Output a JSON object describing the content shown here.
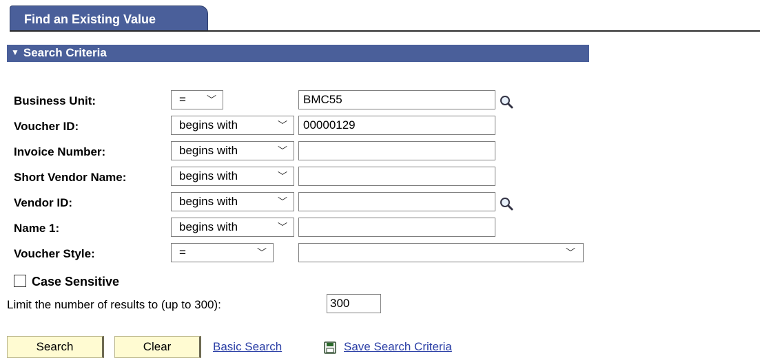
{
  "tab": {
    "label": "Find an Existing Value"
  },
  "section": {
    "title": "Search Criteria"
  },
  "fields": [
    {
      "label": "Business Unit:",
      "operator": "=",
      "value": "BMC55",
      "lookup": true
    },
    {
      "label": "Voucher ID:",
      "operator": "begins with",
      "value": "00000129",
      "lookup": false
    },
    {
      "label": "Invoice Number:",
      "operator": "begins with",
      "value": "",
      "lookup": false
    },
    {
      "label": "Short Vendor Name:",
      "operator": "begins with",
      "value": "",
      "lookup": false
    },
    {
      "label": "Vendor ID:",
      "operator": "begins with",
      "value": "",
      "lookup": true
    },
    {
      "label": "Name 1:",
      "operator": "begins with",
      "value": "",
      "lookup": false
    },
    {
      "label": "Voucher Style:",
      "operator": "=",
      "value": "",
      "lookup": false
    }
  ],
  "case_sensitive": {
    "label": "Case Sensitive",
    "checked": false
  },
  "limit": {
    "label": "Limit the number of results to (up to 300):",
    "value": "300"
  },
  "buttons": {
    "search": "Search",
    "clear": "Clear"
  },
  "links": {
    "basic_search": "Basic Search",
    "save_search_criteria": "Save Search Criteria"
  },
  "icons": {
    "lookup": "magnifier-icon",
    "save": "save-disk-icon"
  },
  "colors": {
    "header_bar": "#4a5f9a",
    "button_bg": "#fffbd2",
    "link": "#2b3fa6"
  }
}
